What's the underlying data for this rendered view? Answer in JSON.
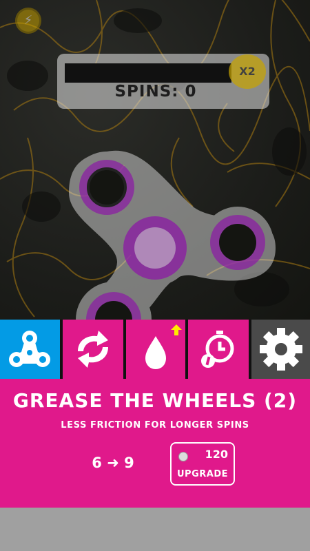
{
  "hud": {
    "coin_icon": "lightning-bolt-icon",
    "coin_symbol": "⚡",
    "multiplier_label": "X2",
    "spins_label": "SPINS: 0"
  },
  "tabs": [
    {
      "name": "spinners",
      "icon": "fidget-spinner-icon",
      "color": "#039be5"
    },
    {
      "name": "refresh",
      "icon": "refresh-arrows-icon",
      "color": "#e0198b"
    },
    {
      "name": "grease",
      "icon": "water-drop-icon",
      "color": "#e0198b",
      "badge_icon": "upgrade-arrow-icon"
    },
    {
      "name": "time",
      "icon": "timer-icon",
      "color": "#e0198b"
    },
    {
      "name": "settings",
      "icon": "gear-icon",
      "color": "#4a4a4a"
    }
  ],
  "upgrade_panel": {
    "title": "GREASE THE WHEELS (2)",
    "description": "LESS FRICTION FOR LONGER SPINS",
    "stat_change": "6 ➜ 9",
    "cost": "120",
    "button_label": "UPGRADE"
  },
  "colors": {
    "accent_pink": "#e0198b",
    "active_tab_blue": "#039be5",
    "spinner_purple": "#8b1fa3",
    "footer_gray": "#a0a0a0"
  }
}
